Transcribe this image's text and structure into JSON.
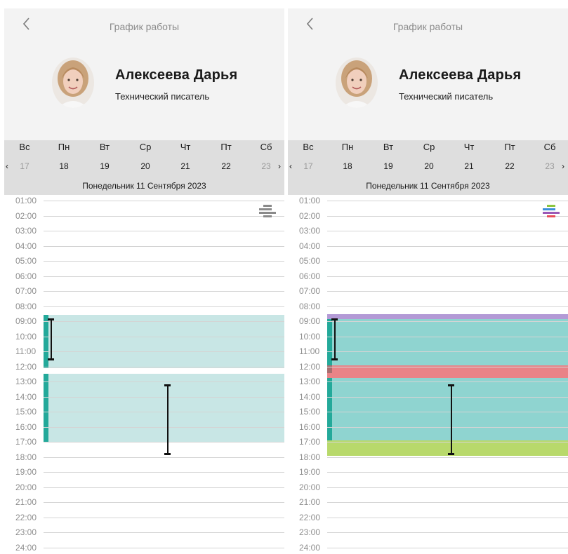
{
  "screens": [
    {
      "variant": "plain",
      "title": "График работы",
      "employee": {
        "name": "Алексеева  Дарья",
        "position": "Технический писатель"
      },
      "week": {
        "days_of_week": [
          "Вс",
          "Пн",
          "Вт",
          "Ср",
          "Чт",
          "Пт",
          "Сб"
        ],
        "dates": [
          "17",
          "18",
          "19",
          "20",
          "21",
          "22",
          "23"
        ],
        "prev_arrow": "‹",
        "next_arrow": "›",
        "selected_date_caption": "Понедельник 11 Сентября 2023"
      },
      "hours": [
        "01:00",
        "02:00",
        "03:00",
        "04:00",
        "05:00",
        "06:00",
        "07:00",
        "08:00",
        "09:00",
        "10:00",
        "11:00",
        "12:00",
        "13:00",
        "14:00",
        "15:00",
        "16:00",
        "17:00",
        "18:00",
        "19:00",
        "20:00",
        "21:00",
        "22:00",
        "23:00",
        "24:00"
      ],
      "colors": {
        "legend": [
          "#8a8a8a",
          "#8a8a8a",
          "#8a8a8a",
          "#8a8a8a"
        ]
      }
    },
    {
      "variant": "colored",
      "title": "График работы",
      "employee": {
        "name": "Алексеева  Дарья",
        "position": "Технический писатель"
      },
      "week": {
        "days_of_week": [
          "Вс",
          "Пн",
          "Вт",
          "Ср",
          "Чт",
          "Пт",
          "Сб"
        ],
        "dates": [
          "17",
          "18",
          "19",
          "20",
          "21",
          "22",
          "23"
        ],
        "prev_arrow": "‹",
        "next_arrow": "›",
        "selected_date_caption": "Понедельник 11 Сентября 2023"
      },
      "hours": [
        "01:00",
        "02:00",
        "03:00",
        "04:00",
        "05:00",
        "06:00",
        "07:00",
        "08:00",
        "09:00",
        "10:00",
        "11:00",
        "12:00",
        "13:00",
        "14:00",
        "15:00",
        "16:00",
        "17:00",
        "18:00",
        "19:00",
        "20:00",
        "21:00",
        "22:00",
        "23:00",
        "24:00"
      ],
      "colors": {
        "legend": [
          "#8dc63f",
          "#3b8fd9",
          "#9b59b6",
          "#e84c5a"
        ]
      }
    }
  ],
  "colors": {
    "teal_bar": "#23a99a",
    "teal_light": "#c8e6e5",
    "teal_mid": "#8fd4d0",
    "purple": "#b39ad6",
    "pink": "#e98387",
    "lime": "#b8d96b"
  },
  "icons": {
    "back": "chevron-left-icon",
    "avatar": "avatar"
  }
}
